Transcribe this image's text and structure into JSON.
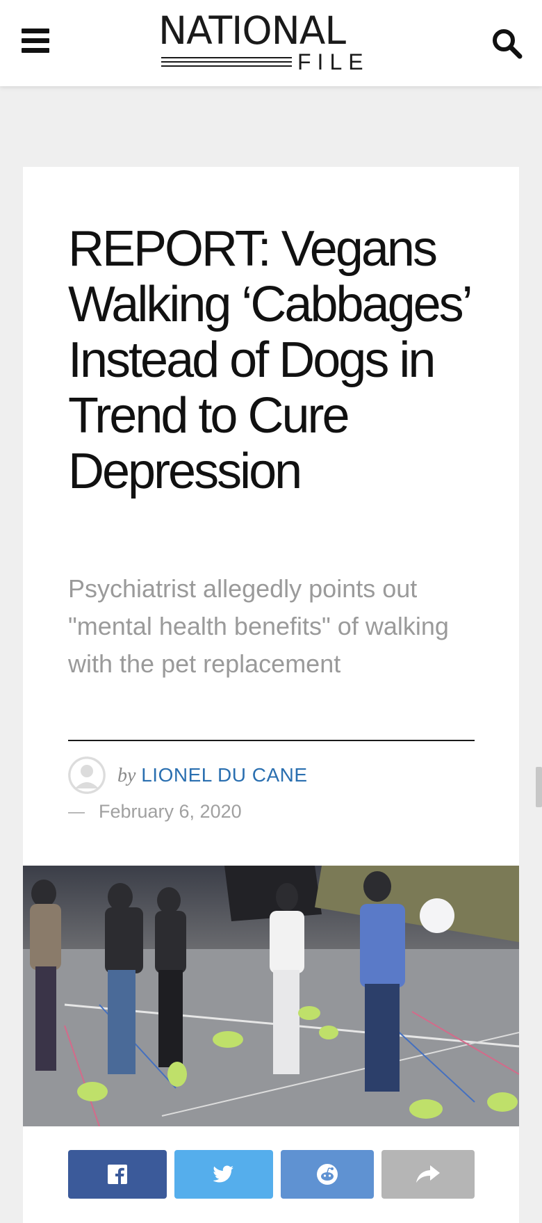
{
  "header": {
    "logo_top": "NATIONAL",
    "logo_bottom": "FILE",
    "menu_icon": "hamburger-menu-icon",
    "search_icon": "search-icon"
  },
  "article": {
    "headline": "REPORT: Vegans Walking ‘Cabbages’ Instead of Dogs in Trend to Cure Depression",
    "subtitle": "Psychiatrist allegedly points out \"mental health benefits\" of walking with the pet replacement",
    "by_word": "by",
    "author": "LIONEL DU CANE",
    "date": "February 6, 2020"
  },
  "share": [
    {
      "network": "facebook",
      "icon": "facebook-icon",
      "color": "#3b5a9a"
    },
    {
      "network": "twitter",
      "icon": "twitter-icon",
      "color": "#55aeec"
    },
    {
      "network": "reddit",
      "icon": "reddit-icon",
      "color": "#5f92d2"
    },
    {
      "network": "more",
      "icon": "share-arrow-icon",
      "color": "#b5b5b5"
    }
  ],
  "colors": {
    "author_link": "#2a6fb0",
    "page_background": "#efefef"
  }
}
